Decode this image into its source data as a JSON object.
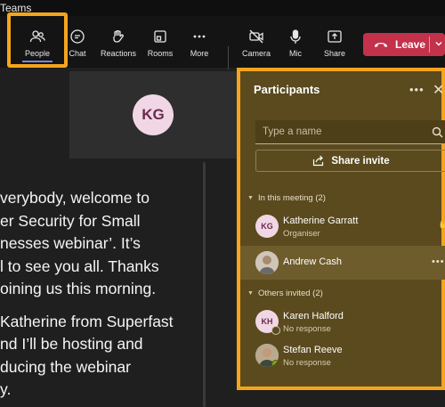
{
  "window": {
    "title": "Teams"
  },
  "toolbar": {
    "people": "People",
    "chat": "Chat",
    "reactions": "Reactions",
    "rooms": "Rooms",
    "more": "More",
    "camera": "Camera",
    "mic": "Mic",
    "share": "Share",
    "leave": "Leave",
    "accent": "#7b83eb",
    "leave_color": "#c4314b"
  },
  "stage": {
    "speaker_initials": "KG",
    "caption_lines": [
      "verybody, welcome to",
      "er Security for Small",
      "nesses webinar’. It’s",
      "l to see you all. Thanks",
      "oining us this morning.",
      "",
      "Katherine from Superfast",
      "nd I’ll be hosting and",
      "ducing the webinar",
      "y."
    ]
  },
  "participants": {
    "title": "Participants",
    "search_placeholder": "Type a name",
    "share_invite": "Share invite",
    "in_meeting_header": "In this meeting (2)",
    "invited_header": "Others invited (2)",
    "in_meeting": [
      {
        "initials": "KG",
        "name": "Katherine Garratt",
        "role": "Organiser"
      },
      {
        "initials": "",
        "name": "Andrew Cash",
        "role": ""
      }
    ],
    "invited": [
      {
        "initials": "KH",
        "name": "Karen Halford",
        "status": "No response"
      },
      {
        "initials": "",
        "name": "Stefan Reeve",
        "status": "No response"
      }
    ],
    "highlight_color": "#f5a51c"
  }
}
